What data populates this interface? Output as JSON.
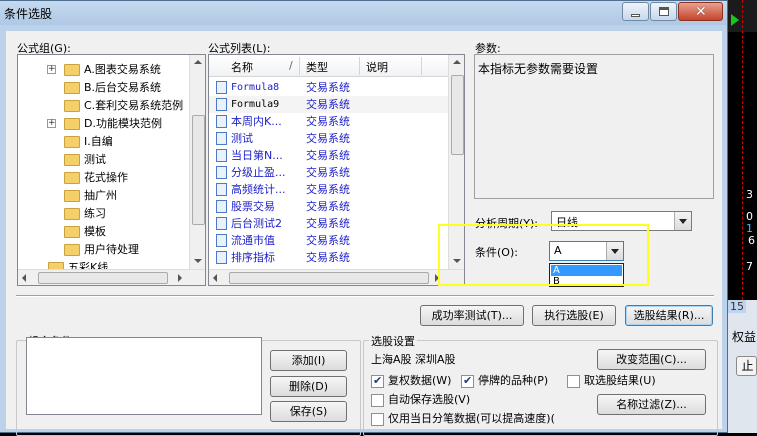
{
  "window": {
    "title": "条件选股"
  },
  "formula_group": {
    "label": "公式组(G):",
    "items": [
      {
        "label": "A.图表交易系统",
        "expandable": true
      },
      {
        "label": "B.后台交易系统",
        "expandable": false
      },
      {
        "label": "C.套利交易系统范例",
        "expandable": false
      },
      {
        "label": "D.功能模块范例",
        "expandable": true
      },
      {
        "label": "I.自编",
        "expandable": false
      },
      {
        "label": "测试",
        "expandable": false
      },
      {
        "label": "花式操作",
        "expandable": false
      },
      {
        "label": "抽广州",
        "expandable": false
      },
      {
        "label": "练习",
        "expandable": false
      },
      {
        "label": "模板",
        "expandable": false
      },
      {
        "label": "用户待处理",
        "expandable": false
      },
      {
        "label": "五彩K线",
        "expandable": false
      }
    ]
  },
  "formula_list": {
    "label": "公式列表(L):",
    "headers": {
      "name": "名称",
      "type": "类型",
      "desc": "说明"
    },
    "rows": [
      {
        "name": "Formula8",
        "type": "交易系统"
      },
      {
        "name": "Formula9",
        "type": "交易系统"
      },
      {
        "name": "本周内K...",
        "type": "交易系统"
      },
      {
        "name": "测试",
        "type": "交易系统"
      },
      {
        "name": "当日第N...",
        "type": "交易系统"
      },
      {
        "name": "分级止盈...",
        "type": "交易系统"
      },
      {
        "name": "高频统计...",
        "type": "交易系统"
      },
      {
        "name": "股票交易",
        "type": "交易系统"
      },
      {
        "name": "后台测试2",
        "type": "交易系统"
      },
      {
        "name": "流通市值",
        "type": "交易系统"
      },
      {
        "name": "排序指标",
        "type": "交易系统"
      }
    ]
  },
  "params": {
    "label": "参数:",
    "text": "本指标无参数需要设置"
  },
  "period": {
    "label": "分析周期(Y):",
    "value": "日线"
  },
  "condition": {
    "label": "条件(O):",
    "value": "A",
    "options": [
      "A",
      "B"
    ]
  },
  "buttons": {
    "success_test": "成功率测试(T)...",
    "run_select": "执行选股(E)",
    "select_result": "选股结果(R)...",
    "add": "添加(I)",
    "delete": "删除(D)",
    "save": "保存(S)",
    "change_range": "改变范围(C)...",
    "name_filter": "名称过滤(Z)..."
  },
  "combo_conditions": {
    "label": "组合条件"
  },
  "select_settings": {
    "label": "选股设置",
    "range_text": "上海A股   深圳A股",
    "checkboxes": {
      "rights_data": {
        "label": "复权数据(W)",
        "checked": true
      },
      "suspended": {
        "label": "停牌的品种(P)",
        "checked": true
      },
      "fetch_result": {
        "label": "取选股结果(U)",
        "checked": false
      },
      "auto_save": {
        "label": "自动保存选股(V)",
        "checked": false
      },
      "today_only": {
        "label": "仅用当日分笔数据(可以提高速度)(",
        "checked": false
      }
    }
  },
  "background_app": {
    "labels": [
      "3",
      "0",
      "1",
      "6",
      "7",
      "15",
      "权益",
      "止"
    ]
  }
}
